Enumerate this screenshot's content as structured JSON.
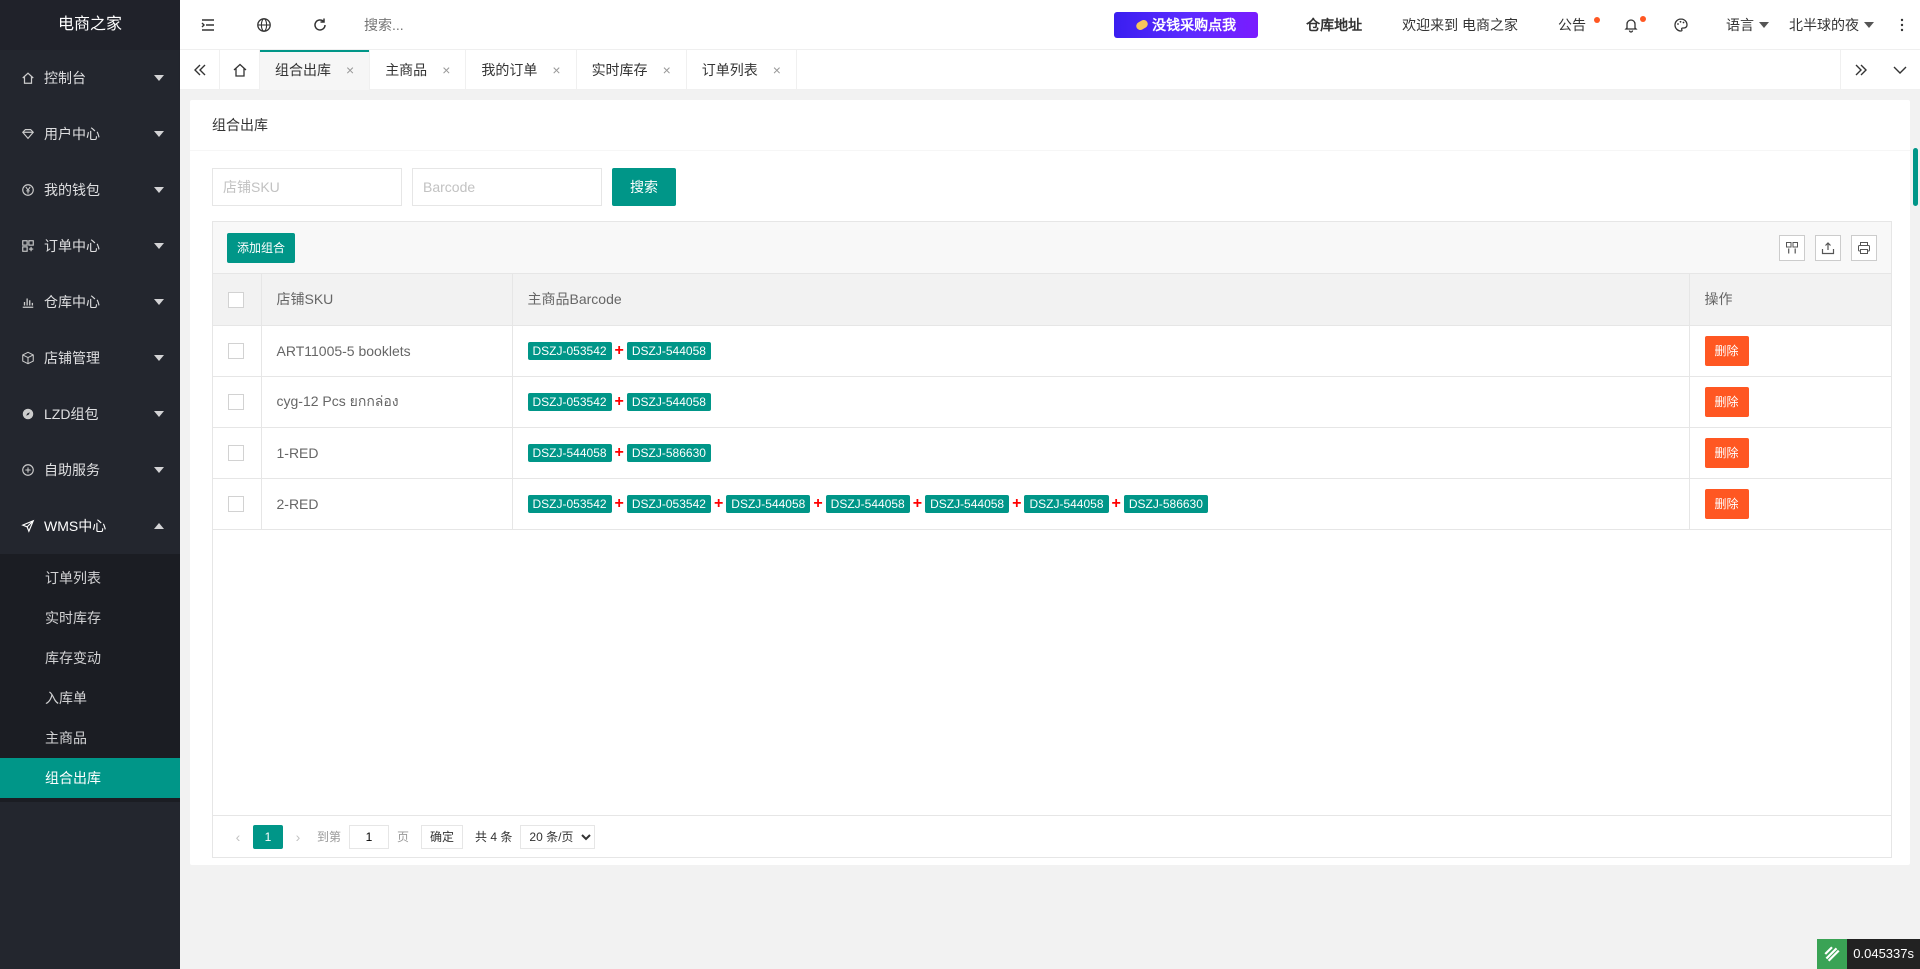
{
  "app": {
    "name": "电商之家"
  },
  "colors": {
    "accent": "#009688",
    "danger": "#ff5722",
    "sidebar": "#23262e"
  },
  "sidebar": {
    "menus": [
      {
        "label": "控制台",
        "icon": "home-icon"
      },
      {
        "label": "用户中心",
        "icon": "diamond-icon"
      },
      {
        "label": "我的钱包",
        "icon": "yen-icon"
      },
      {
        "label": "订单中心",
        "icon": "apps-icon"
      },
      {
        "label": "仓库中心",
        "icon": "chart-icon"
      },
      {
        "label": "店铺管理",
        "icon": "cube-icon"
      },
      {
        "label": "LZD组包",
        "icon": "compass-icon"
      },
      {
        "label": "自助服务",
        "icon": "service-icon"
      },
      {
        "label": "WMS中心",
        "icon": "send-icon"
      }
    ],
    "wms_sub": [
      "订单列表",
      "实时库存",
      "库存变动",
      "入库单",
      "主商品",
      "组合出库"
    ]
  },
  "header": {
    "search_placeholder": "搜索...",
    "promo": "没钱采购点我",
    "warehouse": "仓库地址",
    "welcome": "欢迎来到 电商之家",
    "notice": "公告",
    "language": "语言",
    "user": "北半球的夜"
  },
  "tabs": [
    "组合出库",
    "主商品",
    "我的订单",
    "实时库存",
    "订单列表"
  ],
  "page": {
    "title": "组合出库",
    "sku_placeholder": "店铺SKU",
    "barcode_placeholder": "Barcode",
    "search_btn": "搜索",
    "add_btn": "添加组合"
  },
  "table": {
    "headers": {
      "sku": "店铺SKU",
      "barcode": "主商品Barcode",
      "op": "操作"
    },
    "delete_label": "删除",
    "rows": [
      {
        "sku": "ART11005-5 booklets",
        "barcodes": [
          "DSZJ-053542",
          "DSZJ-544058"
        ]
      },
      {
        "sku": "cyg-12 Pcs ยกกล่อง",
        "barcodes": [
          "DSZJ-053542",
          "DSZJ-544058"
        ]
      },
      {
        "sku": "1-RED",
        "barcodes": [
          "DSZJ-544058",
          "DSZJ-586630"
        ]
      },
      {
        "sku": "2-RED",
        "barcodes": [
          "DSZJ-053542",
          "DSZJ-053542",
          "DSZJ-544058",
          "DSZJ-544058",
          "DSZJ-544058",
          "DSZJ-544058",
          "DSZJ-586630"
        ]
      }
    ]
  },
  "pager": {
    "current": "1",
    "goto_label": "到第",
    "goto_value": "1",
    "page_unit": "页",
    "confirm": "确定",
    "total": "共 4 条",
    "page_size": "20 条/页"
  },
  "timing": "0.045337s"
}
